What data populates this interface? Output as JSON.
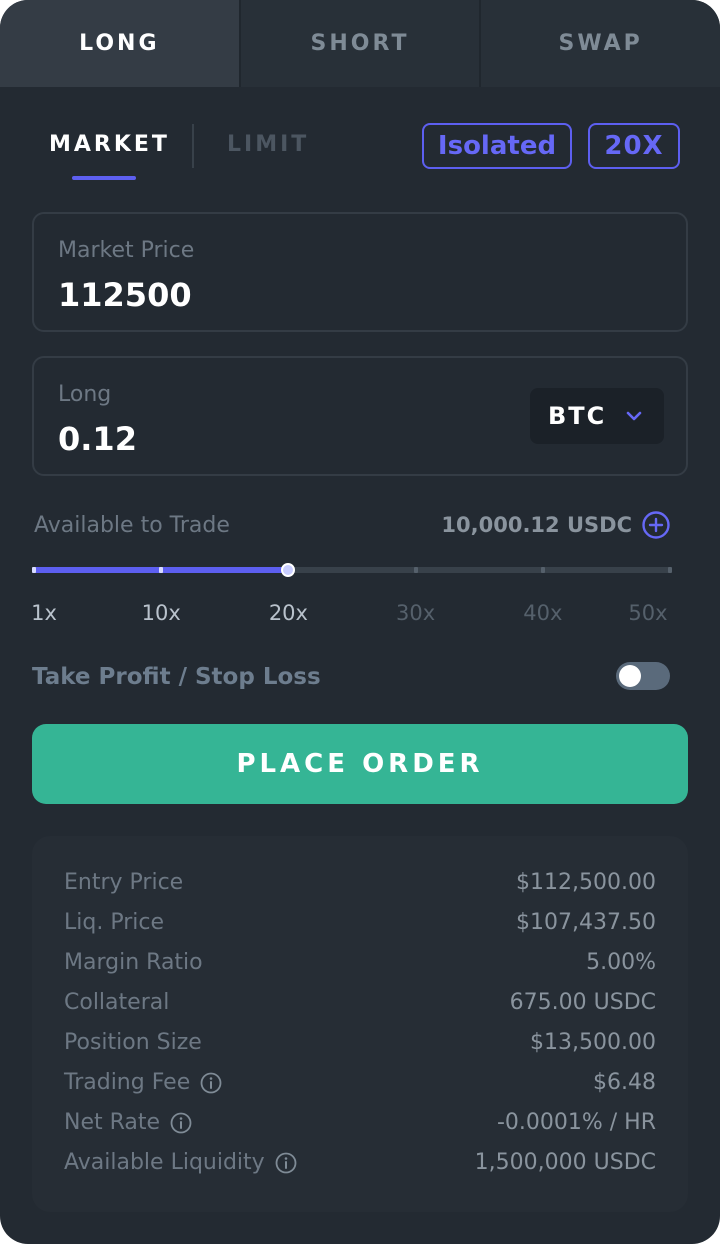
{
  "tabs": [
    {
      "label": "LONG",
      "active": true
    },
    {
      "label": "SHORT",
      "active": false
    },
    {
      "label": "SWAP",
      "active": false
    }
  ],
  "order_types": {
    "market": "MARKET",
    "limit": "LIMIT",
    "selected": "MARKET"
  },
  "margin_mode": "Isolated",
  "leverage_badge": "20X",
  "price_box": {
    "label": "Market Price",
    "value": "112500"
  },
  "long_box": {
    "label": "Long",
    "value": "0.12",
    "asset": "BTC",
    "asset_icon": "chevron-down-icon"
  },
  "available": {
    "label": "Available to Trade",
    "value": "10,000.12 USDC",
    "icon": "plus-circle-icon"
  },
  "leverage_slider": {
    "labels": [
      "1x",
      "10x",
      "20x",
      "30x",
      "40x",
      "50x"
    ],
    "min": 1,
    "max": 50,
    "selected": 20
  },
  "tpsl": {
    "take_profit": "Take Profit",
    "separator": "/",
    "stop_loss": "Stop Loss",
    "enabled": false
  },
  "place_order": "PLACE ORDER",
  "summary": [
    {
      "key": "Entry Price",
      "value": "$112,500.00",
      "info": false
    },
    {
      "key": "Liq. Price",
      "value": "$107,437.50",
      "info": false
    },
    {
      "key": "Margin Ratio",
      "value": "5.00%",
      "info": false
    },
    {
      "key": "Collateral",
      "value": "675.00 USDC",
      "info": false
    },
    {
      "key": "Position Size",
      "value": "$13,500.00",
      "info": false
    },
    {
      "key": "Trading Fee",
      "value": "$6.48",
      "info": true
    },
    {
      "key": "Net Rate",
      "value": "-0.0001% / HR",
      "info": true
    },
    {
      "key": "Available Liquidity",
      "value": "1,500,000 USDC",
      "info": true
    }
  ],
  "colors": {
    "accent": "#5d5ff0",
    "success": "#35b595",
    "panel": "#232a32"
  }
}
